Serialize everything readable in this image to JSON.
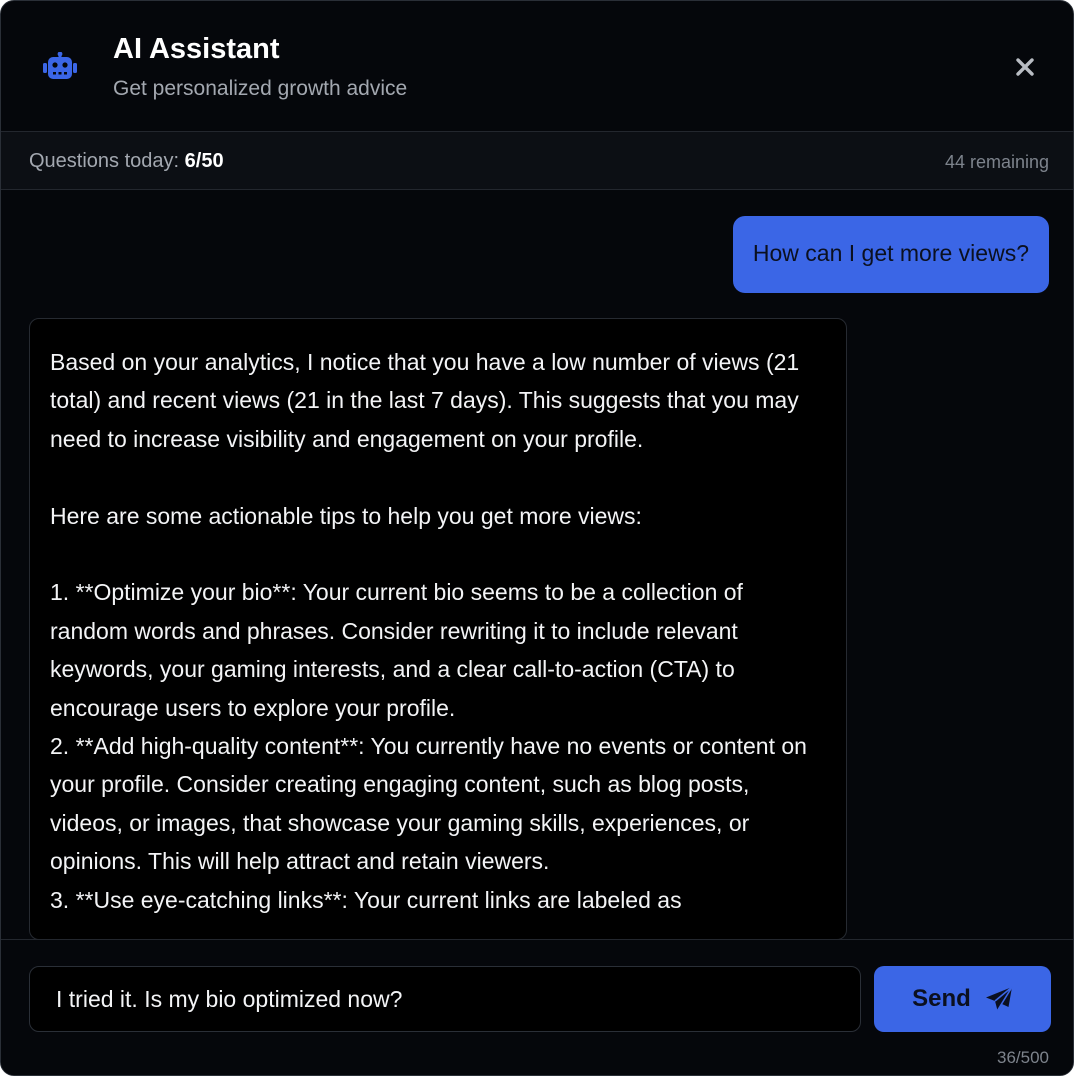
{
  "header": {
    "title": "AI Assistant",
    "subtitle": "Get personalized growth advice",
    "icon": "robot-icon",
    "close_icon": "close-icon",
    "accent_color": "#3b66e6"
  },
  "quota": {
    "label": "Questions today: ",
    "count": "6/50",
    "remaining": "44 remaining"
  },
  "messages": {
    "user": "How can I get more views?",
    "assistant": "Based on your analytics, I notice that you have a low number of views (21 total) and recent views (21 in the last 7 days). This suggests that you may need to increase visibility and engagement on your profile.\n\nHere are some actionable tips to help you get more views:\n\n1. **Optimize your bio**: Your current bio seems to be a collection of random words and phrases. Consider rewriting it to include relevant keywords, your gaming interests, and a clear call-to-action (CTA) to encourage users to explore your profile.\n2. **Add high-quality content**: You currently have no events or content on your profile. Consider creating engaging content, such as blog posts, videos, or images, that showcase your gaming skills, experiences, or opinions. This will help attract and retain viewers.\n3. **Use eye-catching links**: Your current links are labeled as"
  },
  "input": {
    "value": "I tried it. Is my bio optimized now?",
    "send_label": "Send",
    "send_icon": "paper-plane-icon",
    "char_count": "36/500"
  }
}
